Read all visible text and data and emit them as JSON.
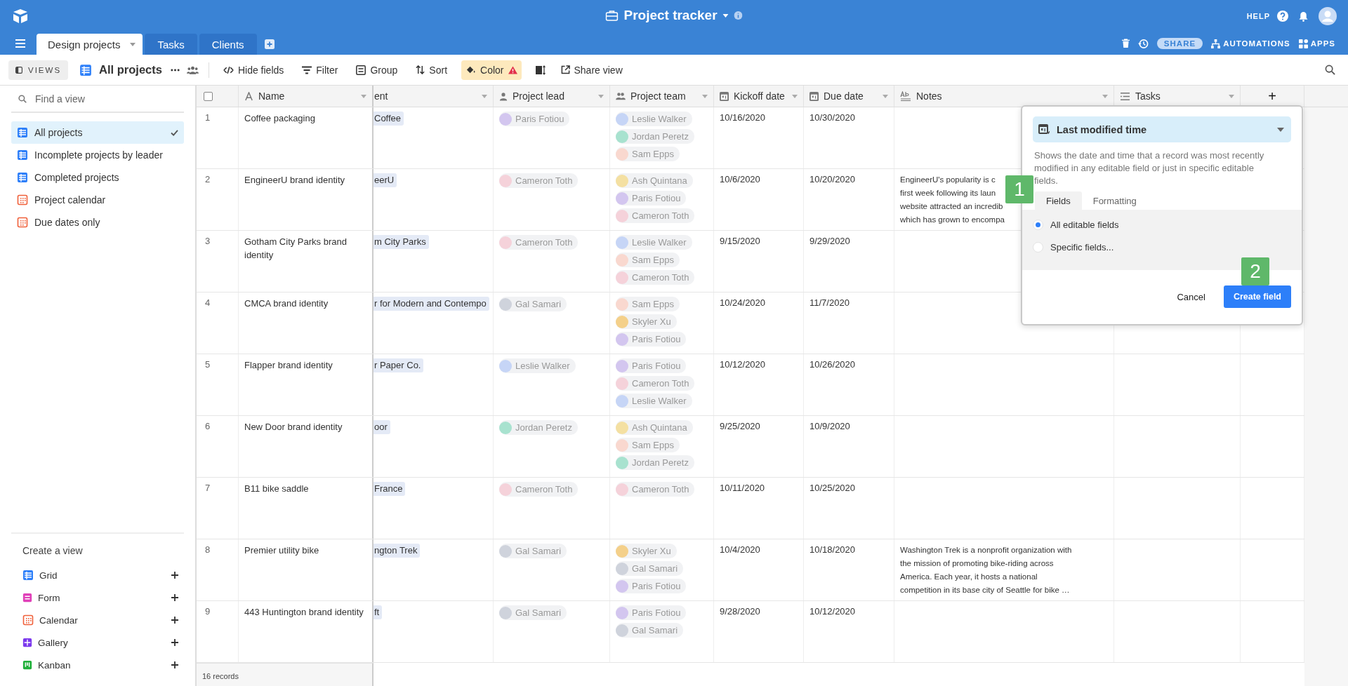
{
  "app": {
    "title": "Project tracker",
    "help": "HELP"
  },
  "tabs": [
    {
      "label": "Design projects",
      "selected": true
    },
    {
      "label": "Tasks",
      "selected": false
    },
    {
      "label": "Clients",
      "selected": false
    }
  ],
  "actions": {
    "share": "SHARE",
    "automations": "AUTOMATIONS",
    "apps": "APPS"
  },
  "toolbar": {
    "views": "VIEWS",
    "view_name": "All projects",
    "buttons": [
      {
        "kind": "hide",
        "label": "Hide fields"
      },
      {
        "kind": "filter",
        "label": "Filter"
      },
      {
        "kind": "group",
        "label": "Group"
      },
      {
        "kind": "sort",
        "label": "Sort"
      },
      {
        "kind": "color",
        "label": "Color",
        "warning": true
      },
      {
        "kind": "row-height"
      },
      {
        "kind": "share",
        "label": "Share view"
      }
    ]
  },
  "sidebar": {
    "search": {
      "placeholder": "Find a view"
    },
    "views": [
      {
        "label": "All projects",
        "kind": "grid",
        "selected": true
      },
      {
        "label": "Incomplete projects by leader",
        "kind": "grid",
        "selected": false
      },
      {
        "label": "Completed projects",
        "kind": "grid",
        "selected": false
      },
      {
        "label": "Project calendar",
        "kind": "calendar",
        "selected": false
      },
      {
        "label": "Due dates only",
        "kind": "calendar",
        "selected": false
      }
    ],
    "create_heading": "Create a view",
    "create_options": [
      {
        "label": "Grid",
        "kind": "grid",
        "color": "#2d7ff9"
      },
      {
        "label": "Form",
        "kind": "form",
        "color": "#e040b8"
      },
      {
        "label": "Calendar",
        "kind": "calendar",
        "color": "#f0603a"
      },
      {
        "label": "Gallery",
        "kind": "gallery",
        "color": "#7c39ed"
      },
      {
        "label": "Kanban",
        "kind": "kanban",
        "color": "#20b03a"
      }
    ]
  },
  "table": {
    "select_all_checked": false,
    "columns": [
      {
        "label": "Name",
        "kind": "text"
      },
      {
        "label": "ent",
        "kind": "link"
      },
      {
        "label": "Project lead",
        "kind": "user"
      },
      {
        "label": "Project team",
        "kind": "users"
      },
      {
        "label": "Kickoff date",
        "kind": "date"
      },
      {
        "label": "Due date",
        "kind": "date"
      },
      {
        "label": "Notes",
        "kind": "longtext"
      },
      {
        "label": "Tasks",
        "kind": "tasks"
      },
      {
        "label": "+",
        "kind": "add"
      }
    ],
    "rows": [
      {
        "number": "1",
        "name": "Coffee packaging",
        "client": "Coffee",
        "lead": {
          "name": "Paris Fotiou",
          "color": "#d3c6ef"
        },
        "team": [
          {
            "name": "Leslie Walker",
            "color": "#c6d5f6"
          },
          {
            "name": "Jordan Peretz",
            "color": "#a8e2cf"
          },
          {
            "name": "Sam Epps",
            "color": "#f9d8cf"
          }
        ],
        "kickoff": "10/16/2020",
        "due": "10/30/2020",
        "notes": []
      },
      {
        "number": "2",
        "name": "EngineerU brand identity",
        "client": "eerU",
        "lead": {
          "name": "Cameron Toth",
          "color": "#f5d2da"
        },
        "team": [
          {
            "name": "Ash Quintana",
            "color": "#f4e0a2"
          },
          {
            "name": "Paris Fotiou",
            "color": "#d3c6ef"
          },
          {
            "name": "Cameron Toth",
            "color": "#f5d2da"
          }
        ],
        "kickoff": "10/6/2020",
        "due": "10/20/2020",
        "notes": [
          "EngineerU's popularity is c",
          "first week following its laun",
          "website attracted an incredib",
          "which has grown to encompa"
        ]
      },
      {
        "number": "3",
        "name": "Gotham City Parks brand identity",
        "client": "m City Parks",
        "lead": {
          "name": "Cameron Toth",
          "color": "#f5d2da"
        },
        "team": [
          {
            "name": "Leslie Walker",
            "color": "#c6d5f6"
          },
          {
            "name": "Sam Epps",
            "color": "#f9d8cf"
          },
          {
            "name": "Cameron Toth",
            "color": "#f5d2da"
          }
        ],
        "kickoff": "9/15/2020",
        "due": "9/29/2020",
        "notes": []
      },
      {
        "number": "4",
        "name": "CMCA brand identity",
        "client": "r for Modern and Contempo",
        "lead": {
          "name": "Gal Samari",
          "color": "#cfd3dc"
        },
        "team": [
          {
            "name": "Sam Epps",
            "color": "#f9d8cf"
          },
          {
            "name": "Skyler Xu",
            "color": "#f4d08a"
          },
          {
            "name": "Paris Fotiou",
            "color": "#d3c6ef"
          }
        ],
        "kickoff": "10/24/2020",
        "due": "11/7/2020",
        "notes": []
      },
      {
        "number": "5",
        "name": "Flapper brand identity",
        "client": "r Paper Co.",
        "lead": {
          "name": "Leslie Walker",
          "color": "#c6d5f6"
        },
        "team": [
          {
            "name": "Paris Fotiou",
            "color": "#d3c6ef"
          },
          {
            "name": "Cameron Toth",
            "color": "#f5d2da"
          },
          {
            "name": "Leslie Walker",
            "color": "#c6d5f6"
          }
        ],
        "kickoff": "10/12/2020",
        "due": "10/26/2020",
        "notes": []
      },
      {
        "number": "6",
        "name": "New Door brand identity",
        "client": "oor",
        "lead": {
          "name": "Jordan Peretz",
          "color": "#a8e2cf"
        },
        "team": [
          {
            "name": "Ash Quintana",
            "color": "#f4e0a2"
          },
          {
            "name": "Sam Epps",
            "color": "#f9d8cf"
          },
          {
            "name": "Jordan Peretz",
            "color": "#a8e2cf"
          }
        ],
        "kickoff": "9/25/2020",
        "due": "10/9/2020",
        "notes": []
      },
      {
        "number": "7",
        "name": "B11 bike saddle",
        "client": "France",
        "lead": {
          "name": "Cameron Toth",
          "color": "#f5d2da"
        },
        "team": [
          {
            "name": "Cameron Toth",
            "color": "#f5d2da"
          }
        ],
        "kickoff": "10/11/2020",
        "due": "10/25/2020",
        "notes": []
      },
      {
        "number": "8",
        "name": "Premier utility bike",
        "client": "ngton Trek",
        "lead": {
          "name": "Gal Samari",
          "color": "#cfd3dc"
        },
        "team": [
          {
            "name": "Skyler Xu",
            "color": "#f4d08a"
          },
          {
            "name": "Gal Samari",
            "color": "#cfd3dc"
          },
          {
            "name": "Paris Fotiou",
            "color": "#d3c6ef"
          }
        ],
        "kickoff": "10/4/2020",
        "due": "10/18/2020",
        "notes": [
          "Washington Trek is a nonprofit organization with",
          "the mission of promoting bike-riding across",
          "America. Each year, it hosts a national",
          "competition in its base city of Seattle for bike …"
        ]
      },
      {
        "number": "9",
        "name": "443 Huntington brand identity",
        "client": "ft",
        "lead": {
          "name": "Gal Samari",
          "color": "#cfd3dc"
        },
        "team": [
          {
            "name": "Paris Fotiou",
            "color": "#d3c6ef"
          },
          {
            "name": "Gal Samari",
            "color": "#cfd3dc"
          }
        ],
        "kickoff": "9/28/2020",
        "due": "10/12/2020",
        "notes": []
      }
    ],
    "footer": "16 records"
  },
  "popup": {
    "field_type": "Last modified time",
    "description": "Shows the date and time that a record was most recently modified in any editable field or just in specific editable fields.",
    "tabs": [
      {
        "label": "Fields",
        "selected": true
      },
      {
        "label": "Formatting",
        "selected": false
      }
    ],
    "options": [
      {
        "label": "All editable fields",
        "selected": true
      },
      {
        "label": "Specific fields...",
        "selected": false
      }
    ],
    "cancel": "Cancel",
    "create": "Create field"
  },
  "annotations": [
    {
      "label": "1"
    },
    {
      "label": "2"
    }
  ]
}
